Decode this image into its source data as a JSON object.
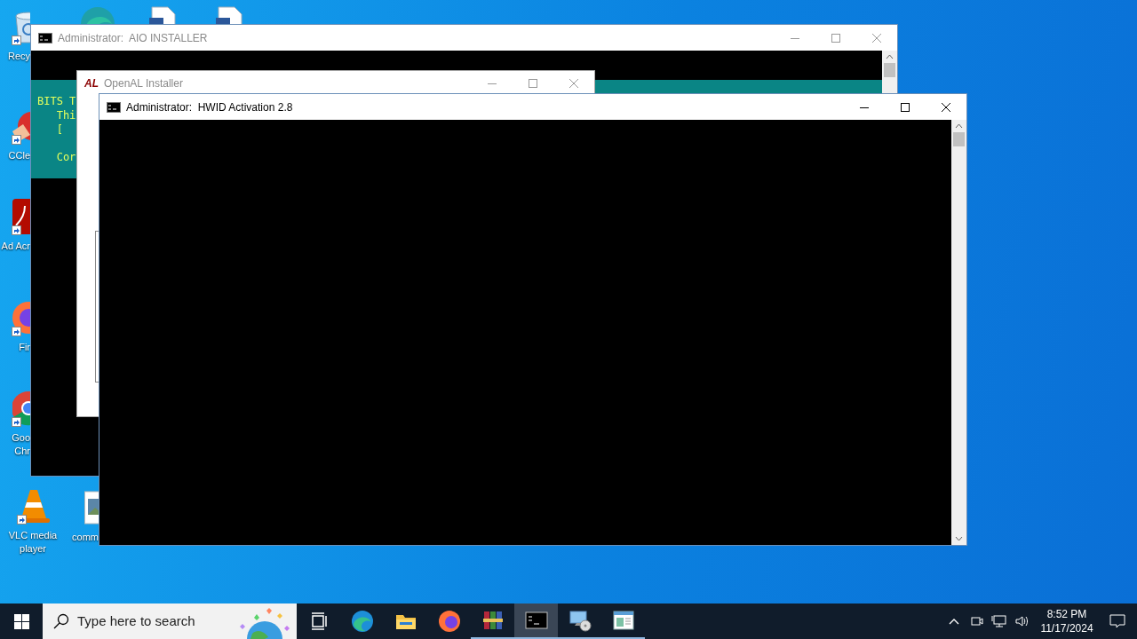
{
  "desktop_icons": [
    {
      "kind": "recycle",
      "label": "Recy"
    },
    {
      "kind": "edge"
    },
    {
      "kind": "doc"
    },
    {
      "kind": "doc"
    },
    {
      "kind": "ccleaner",
      "label": "CCle"
    },
    {
      "kind": "acrobat",
      "label": "Ad Acr"
    },
    {
      "kind": "firefox",
      "label": "Fir"
    },
    {
      "kind": "chrome",
      "label": "Goo Chr"
    },
    {
      "kind": "vlc",
      "label": "VLC media player"
    },
    {
      "kind": "image",
      "label": "comm"
    }
  ],
  "windows": [
    {
      "kind": "console",
      "title": "Administrator:  AIO INSTALLER",
      "banner_blocks": [
        [
          "BITS T",
          "   Thi",
          "   ["
        ],
        [
          "   Cor"
        ]
      ]
    },
    {
      "kind": "installer",
      "logo": "AL",
      "title": "OpenAL Installer"
    },
    {
      "kind": "console",
      "title": "Administrator:  HWID Activation 2.8"
    }
  ],
  "taskbar": {
    "search": {
      "placeholder": "Type here to search"
    },
    "apps": [
      {
        "kind": "taskview",
        "running": false,
        "selected": false
      },
      {
        "kind": "edge",
        "running": false,
        "selected": false
      },
      {
        "kind": "explorer",
        "running": false,
        "selected": false
      },
      {
        "kind": "firefox",
        "running": false,
        "selected": false
      },
      {
        "kind": "winrar",
        "running": true,
        "selected": false
      },
      {
        "kind": "cmd",
        "running": true,
        "selected": true
      },
      {
        "kind": "setup",
        "running": true,
        "selected": false
      },
      {
        "kind": "app",
        "running": true,
        "selected": false
      }
    ],
    "time": "8:52 PM",
    "date": "11/17/2024"
  }
}
